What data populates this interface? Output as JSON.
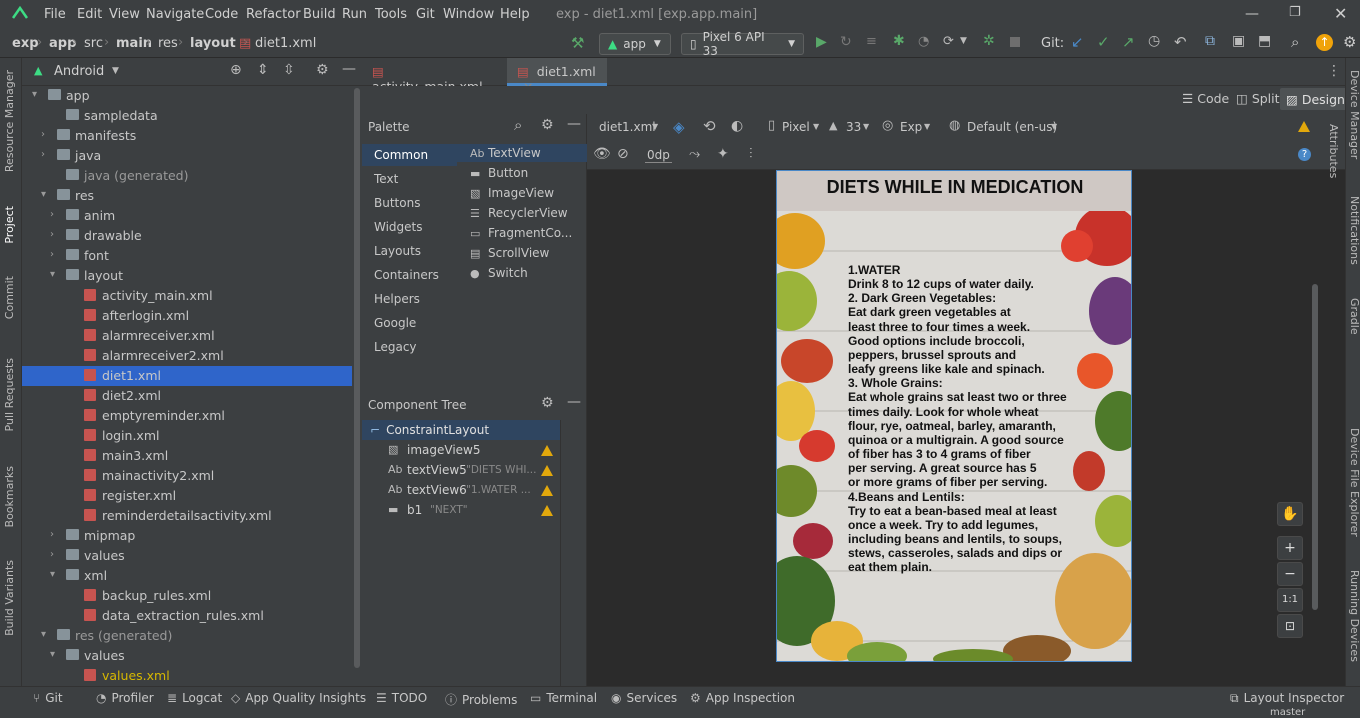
{
  "menu": {
    "items": [
      "File",
      "Edit",
      "View",
      "Navigate",
      "Code",
      "Refactor",
      "Build",
      "Run",
      "Tools",
      "Git",
      "Window",
      "Help"
    ],
    "window_title": "exp - diet1.xml [exp.app.main]"
  },
  "breadcrumb": [
    "exp",
    "app",
    "src",
    "main",
    "res",
    "layout",
    "diet1.xml"
  ],
  "toolbar": {
    "run_config": "app",
    "device": "Pixel 6 API 33",
    "git_label": "Git:"
  },
  "project": {
    "view_label": "Android",
    "tree": [
      {
        "label": "app",
        "indent": 0,
        "arrow": "▾",
        "icon": "folder"
      },
      {
        "label": "sampledata",
        "indent": 2,
        "arrow": "",
        "icon": "folder"
      },
      {
        "label": "manifests",
        "indent": 1,
        "arrow": "›",
        "icon": "folder"
      },
      {
        "label": "java",
        "indent": 1,
        "arrow": "›",
        "icon": "folder"
      },
      {
        "label": "java (generated)",
        "indent": 2,
        "arrow": "",
        "icon": "folder",
        "dim": true
      },
      {
        "label": "res",
        "indent": 1,
        "arrow": "▾",
        "icon": "folder"
      },
      {
        "label": "anim",
        "indent": 2,
        "arrow": "›",
        "icon": "folder"
      },
      {
        "label": "drawable",
        "indent": 2,
        "arrow": "›",
        "icon": "folder"
      },
      {
        "label": "font",
        "indent": 2,
        "arrow": "›",
        "icon": "folder"
      },
      {
        "label": "layout",
        "indent": 2,
        "arrow": "▾",
        "icon": "folder"
      },
      {
        "label": "activity_main.xml",
        "indent": 4,
        "arrow": "",
        "icon": "xml"
      },
      {
        "label": "afterlogin.xml",
        "indent": 4,
        "arrow": "",
        "icon": "xml"
      },
      {
        "label": "alarmreceiver.xml",
        "indent": 4,
        "arrow": "",
        "icon": "xml"
      },
      {
        "label": "alarmreceiver2.xml",
        "indent": 4,
        "arrow": "",
        "icon": "xml"
      },
      {
        "label": "diet1.xml",
        "indent": 4,
        "arrow": "",
        "icon": "xml",
        "selected": true
      },
      {
        "label": "diet2.xml",
        "indent": 4,
        "arrow": "",
        "icon": "xml"
      },
      {
        "label": "emptyreminder.xml",
        "indent": 4,
        "arrow": "",
        "icon": "xml"
      },
      {
        "label": "login.xml",
        "indent": 4,
        "arrow": "",
        "icon": "xml"
      },
      {
        "label": "main3.xml",
        "indent": 4,
        "arrow": "",
        "icon": "xml"
      },
      {
        "label": "mainactivity2.xml",
        "indent": 4,
        "arrow": "",
        "icon": "xml"
      },
      {
        "label": "register.xml",
        "indent": 4,
        "arrow": "",
        "icon": "xml"
      },
      {
        "label": "reminderdetailsactivity.xml",
        "indent": 4,
        "arrow": "",
        "icon": "xml"
      },
      {
        "label": "mipmap",
        "indent": 2,
        "arrow": "›",
        "icon": "folder"
      },
      {
        "label": "values",
        "indent": 2,
        "arrow": "›",
        "icon": "folder"
      },
      {
        "label": "xml",
        "indent": 2,
        "arrow": "▾",
        "icon": "folder"
      },
      {
        "label": "backup_rules.xml",
        "indent": 4,
        "arrow": "",
        "icon": "xml"
      },
      {
        "label": "data_extraction_rules.xml",
        "indent": 4,
        "arrow": "",
        "icon": "xml"
      },
      {
        "label": "res (generated)",
        "indent": 1,
        "arrow": "▾",
        "icon": "folder",
        "dim": true
      },
      {
        "label": "values",
        "indent": 2,
        "arrow": "▾",
        "icon": "folder"
      },
      {
        "label": "values.xml",
        "indent": 4,
        "arrow": "",
        "icon": "xml",
        "yellow": true
      }
    ]
  },
  "left_tabs": [
    "Resource Manager",
    "Project",
    "Commit",
    "Pull Requests",
    "Bookmarks",
    "Build Variants"
  ],
  "right_tabs": [
    "Device Manager",
    "Notifications",
    "Gradle",
    "Device File Explorer",
    "Running Devices"
  ],
  "editor_tabs": [
    {
      "label": "activity_main.xml",
      "active": false
    },
    {
      "label": "diet1.xml",
      "active": true
    }
  ],
  "mode_buttons": {
    "code": "Code",
    "split": "Split",
    "design": "Design"
  },
  "palette": {
    "title": "Palette",
    "categories": [
      "Common",
      "Text",
      "Buttons",
      "Widgets",
      "Layouts",
      "Containers",
      "Helpers",
      "Google",
      "Legacy"
    ],
    "items": [
      "TextView",
      "Button",
      "ImageView",
      "RecyclerView",
      "FragmentCo...",
      "ScrollView",
      "Switch"
    ]
  },
  "component_tree": {
    "title": "Component Tree",
    "root": "ConstraintLayout",
    "children": [
      {
        "name": "imageView5",
        "value": ""
      },
      {
        "name": "textView5",
        "value": "\"DIETS WHI..."
      },
      {
        "name": "textView6",
        "value": "\"1.WATER    ..."
      },
      {
        "name": "b1",
        "value": "\"NEXT\""
      }
    ]
  },
  "design_toolbar": {
    "file": "diet1.xml",
    "device": "Pixel",
    "api": "33",
    "theme": "Exp",
    "locale": "Default (en-us)",
    "margin": "0dp",
    "attributes_tab": "Attributes"
  },
  "phone": {
    "title": "DIETS WHILE IN MEDICATION",
    "lines": [
      "1.WATER",
      "Drink 8 to 12 cups of water daily.",
      "2. Dark Green Vegetables:",
      "Eat dark green vegetables at",
      "least three to four times a week.",
      "Good options include broccoli,",
      "peppers, brussel sprouts and",
      "leafy greens like kale and spinach.",
      "3. Whole Grains:",
      "Eat whole grains sat least two or three",
      "times daily. Look for whole wheat",
      "flour, rye, oatmeal, barley, amaranth,",
      "quinoa or a multigrain. A good source",
      "of fiber has 3 to 4 grams of fiber",
      "per serving. A great source has 5",
      "or more grams of fiber per serving.",
      "4.Beans and Lentils:",
      "Try to eat a bean-based meal at least",
      "once a week. Try to add legumes,",
      "including beans and lentils, to soups,",
      "stews, casseroles, salads and dips or",
      "eat them plain."
    ]
  },
  "zoom": {
    "fit_label": "1:1"
  },
  "bottom_tools": [
    "Git",
    "Profiler",
    "Logcat",
    "App Quality Insights",
    "TODO",
    "Problems",
    "Terminal",
    "Services",
    "App Inspection"
  ],
  "layout_inspector": "Layout Inspector",
  "status": {
    "branch": "master"
  },
  "colors": {
    "accent": "#4a88c7",
    "selection": "#2f65ca",
    "warning": "#e2a80c",
    "run": "#59a869"
  }
}
